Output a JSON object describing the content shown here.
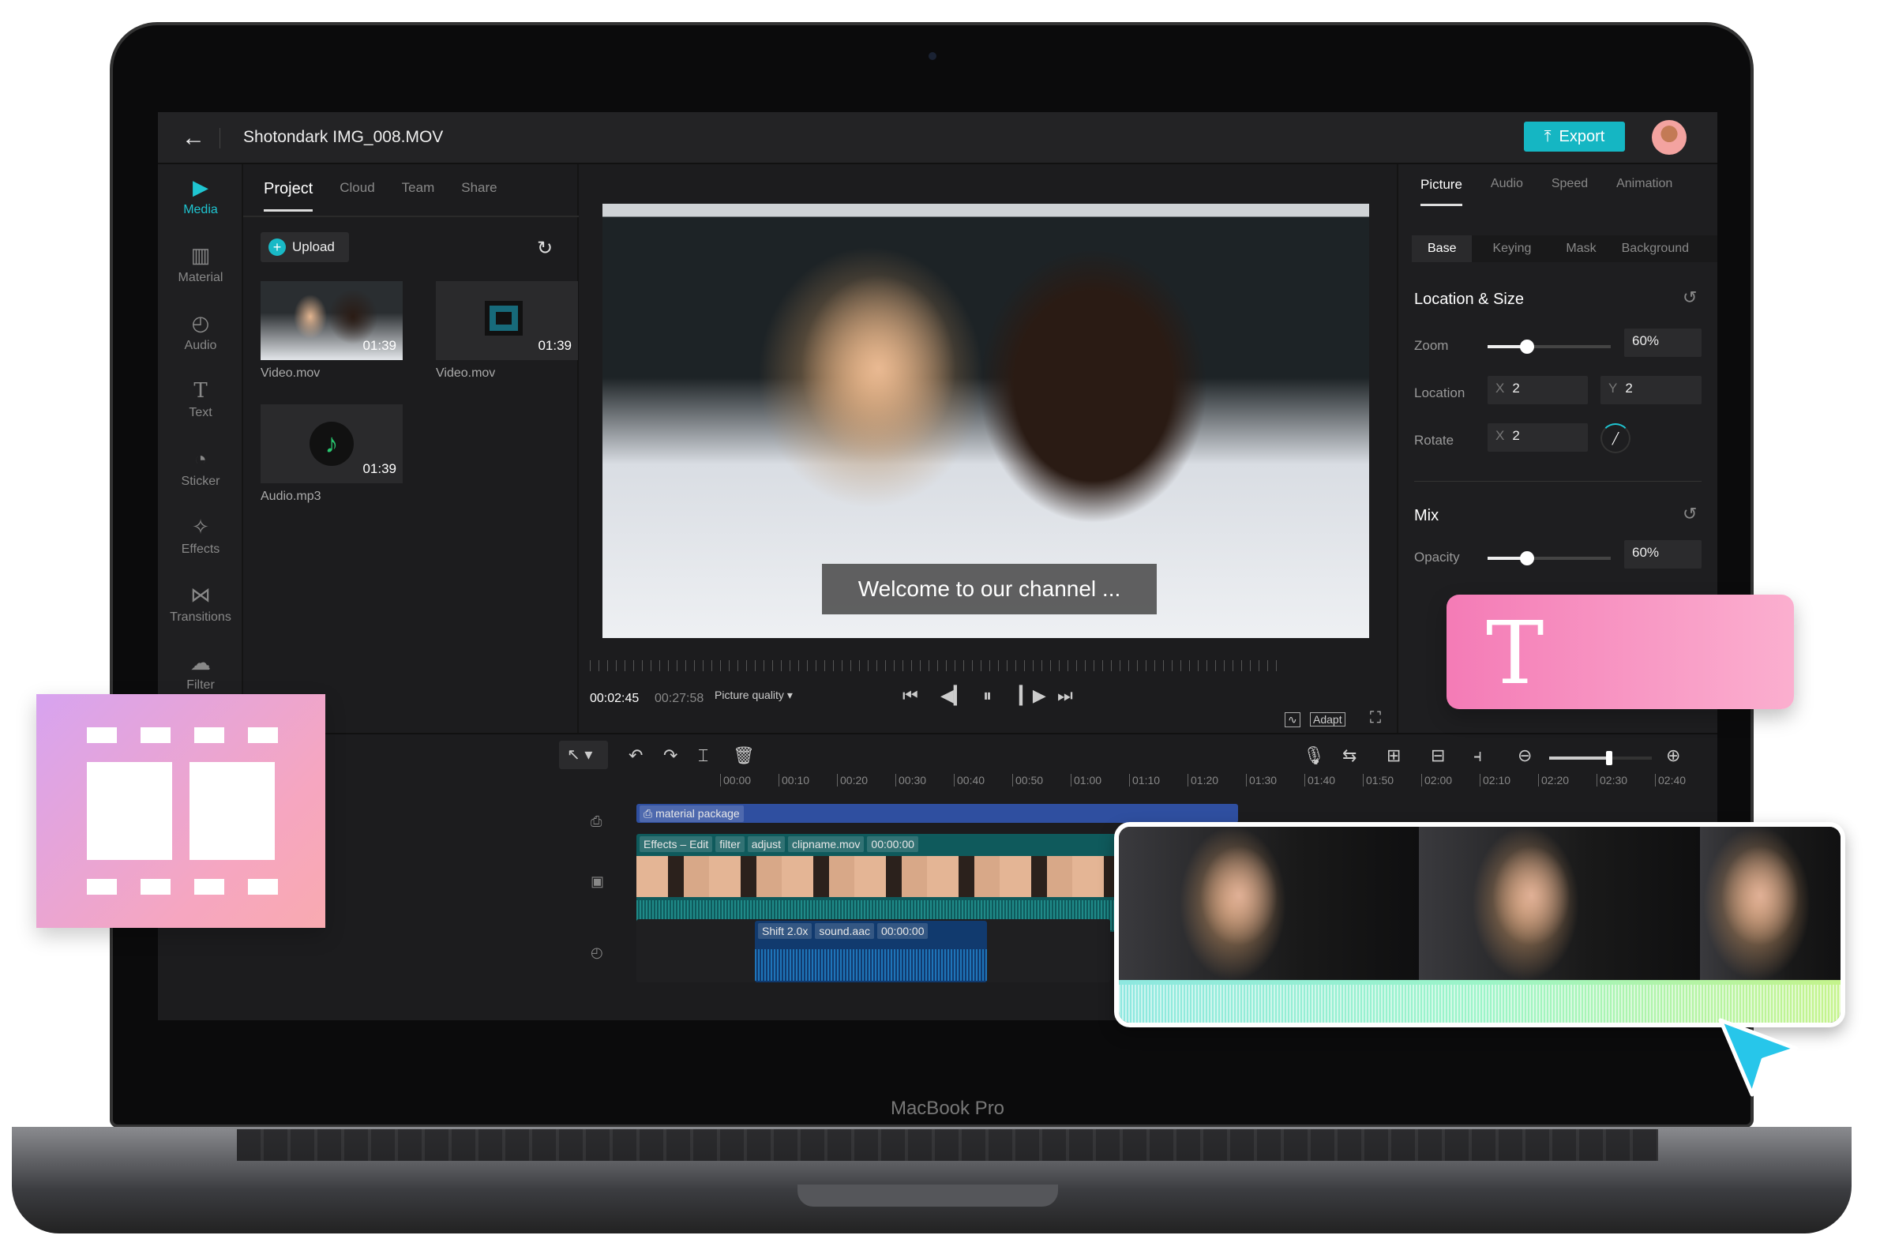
{
  "header": {
    "title": "Shotondark IMG_008.MOV",
    "export_label": "Export"
  },
  "rail": [
    {
      "label": "Media",
      "icon": "play-square-icon"
    },
    {
      "label": "Material",
      "icon": "film-icon"
    },
    {
      "label": "Audio",
      "icon": "music-icon"
    },
    {
      "label": "Text",
      "icon": "text-icon"
    },
    {
      "label": "Sticker",
      "icon": "sticker-icon"
    },
    {
      "label": "Effects",
      "icon": "sparkle-icon"
    },
    {
      "label": "Transitions",
      "icon": "bowtie-icon"
    },
    {
      "label": "Filter",
      "icon": "filter-icon"
    }
  ],
  "media": {
    "tabs": [
      "Project",
      "Cloud",
      "Team",
      "Share"
    ],
    "upload_label": "Upload",
    "items": [
      {
        "name": "Video.mov",
        "duration": "01:39"
      },
      {
        "name": "Video.mov",
        "duration": "01:39"
      },
      {
        "name": "Audio.mp3",
        "duration": "01:39"
      }
    ]
  },
  "preview": {
    "caption": "Welcome to our channel ...",
    "current_time": "00:02:45",
    "total_time": "00:27:58",
    "quality_label": "Picture quality",
    "adapt_label": "Adapt"
  },
  "properties": {
    "tabs": [
      "Picture",
      "Audio",
      "Speed",
      "Animation"
    ],
    "subtabs": [
      "Base",
      "Keying",
      "Mask",
      "Background"
    ],
    "location_size": {
      "title": "Location & Size",
      "zoom_label": "Zoom",
      "zoom_value": "60%",
      "zoom_percent": 60,
      "location_label": "Location",
      "x_key": "X",
      "y_key": "Y",
      "location_x": "2",
      "location_y": "2",
      "rotate_label": "Rotate",
      "rotate_x": "2"
    },
    "mix": {
      "title": "Mix",
      "opacity_label": "Opacity",
      "opacity_value": "60%",
      "opacity_percent": 60
    }
  },
  "timeline": {
    "ticks": [
      "00:00",
      "00:10",
      "00:20",
      "00:30",
      "00:40",
      "00:50",
      "01:00",
      "01:10",
      "01:20",
      "01:30",
      "01:40",
      "01:50",
      "02:00",
      "02:10",
      "02:20",
      "02:30",
      "02:40"
    ],
    "material_track": "material package",
    "video_chips": [
      "Effects – Edit",
      "filter",
      "adjust",
      "clipname.mov",
      "00:00:00"
    ],
    "audio_chips": [
      "Shift 2.0x",
      "sound.aac",
      "00:00:00"
    ]
  },
  "laptop_label": "MacBook Pro",
  "colors": {
    "accent": "#15b6c3",
    "material_track": "#2f4fa0",
    "video_track": "#0f5a5c",
    "audio_track": "#113a6e",
    "text_card": "#f47bb6"
  }
}
